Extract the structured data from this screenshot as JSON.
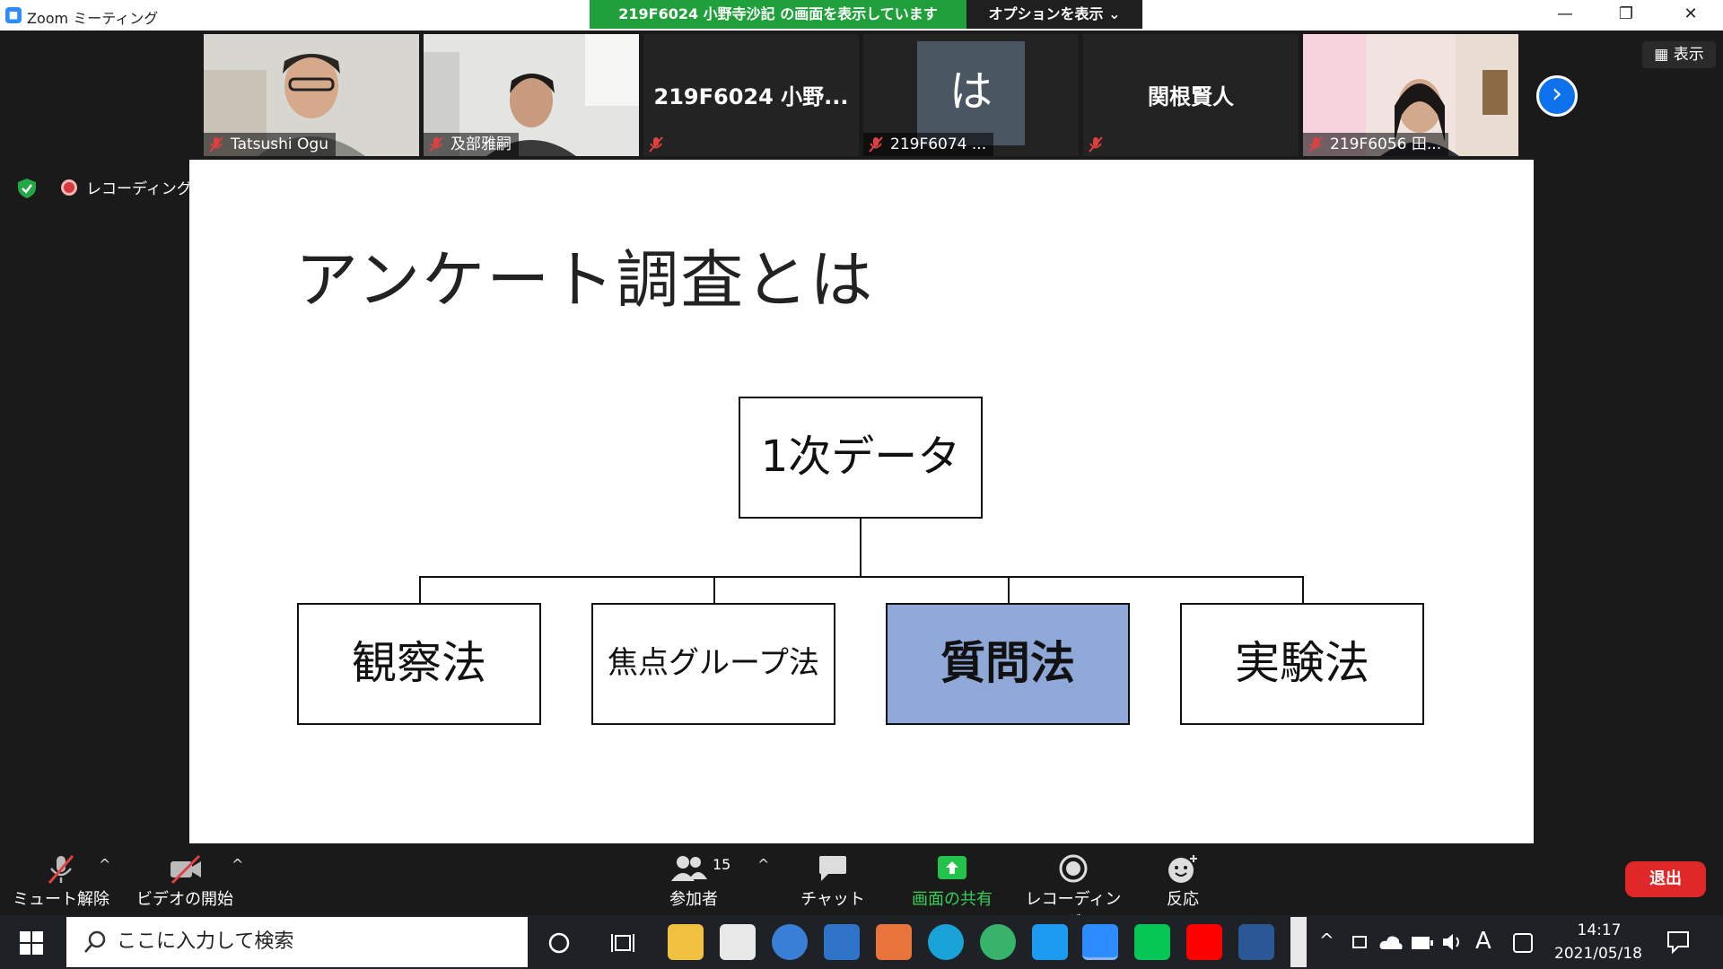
{
  "window": {
    "title": "Zoom ミーティング",
    "app_icon": "zoom-camera-icon"
  },
  "share_banner": {
    "text": "219F6024 小野寺沙記 の画面を表示しています",
    "options_label": "オプションを表示 ⌄"
  },
  "gallery": {
    "view_label": "表示",
    "tiles": [
      {
        "name": "Tatsushi Ogu",
        "type": "video"
      },
      {
        "name": "及部雅嗣",
        "type": "video"
      },
      {
        "name": "219F6024 小野...",
        "type": "name-only",
        "label": ""
      },
      {
        "name": "219F6074 ...",
        "type": "avatar",
        "avatar_char": "は"
      },
      {
        "name": "関根賢人",
        "type": "name-only",
        "label": ""
      },
      {
        "name": "219F6056 田...",
        "type": "video"
      }
    ]
  },
  "status": {
    "recording_label": "レコーディング中"
  },
  "slide": {
    "title": "アンケート調査とは",
    "root_box": "1次データ",
    "children": [
      "観察法",
      "焦点グループ法",
      "質問法",
      "実験法"
    ],
    "highlight_color": "#8fa8d8"
  },
  "toolbar": {
    "unmute_label": "ミュート解除",
    "start_video_label": "ビデオの開始",
    "participants_label": "参加者",
    "participants_count": "15",
    "chat_label": "チャット",
    "share_label": "画面の共有",
    "record_label": "レコーディング",
    "reactions_label": "反応",
    "leave_label": "退出"
  },
  "taskbar": {
    "search_placeholder": "ここに入力して検索",
    "time": "14:17",
    "date": "2021/05/18",
    "ime": "A"
  }
}
